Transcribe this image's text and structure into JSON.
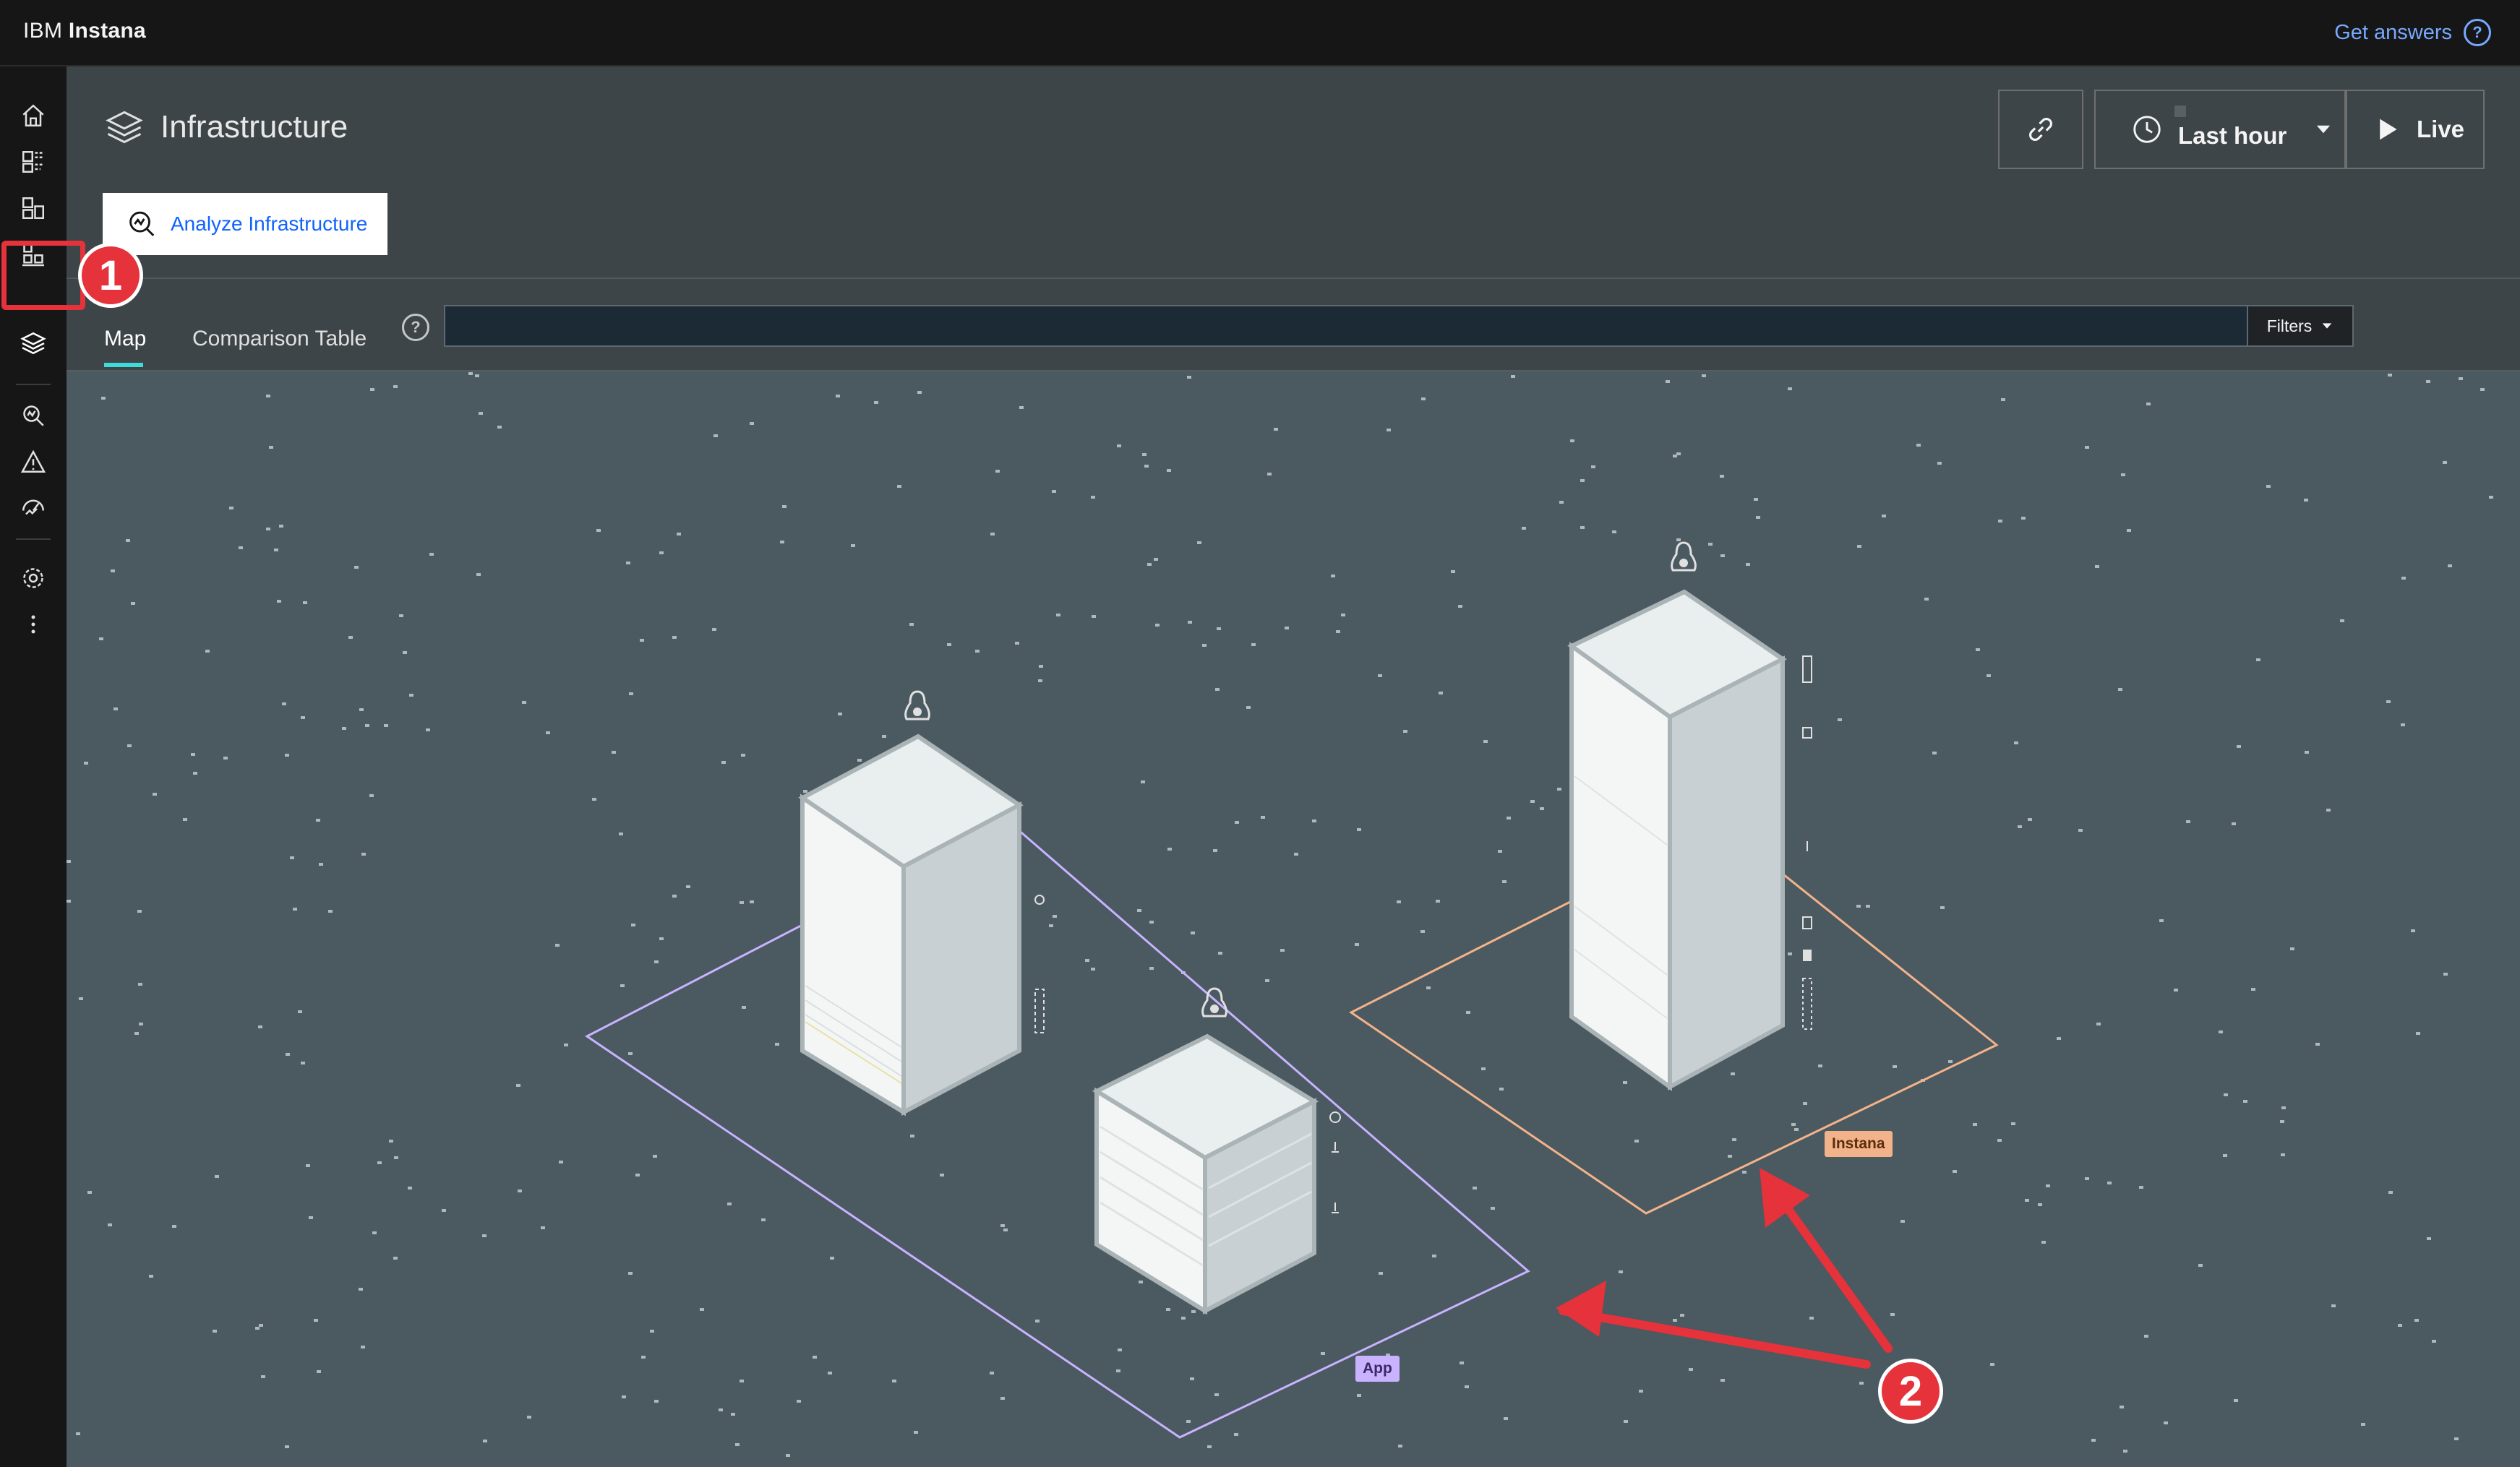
{
  "header": {
    "brand_prefix": "IBM",
    "brand_name": "Instana",
    "get_answers": "Get answers"
  },
  "sidenav": {
    "items": [
      {
        "name": "home",
        "icon": "home-icon"
      },
      {
        "name": "websites",
        "icon": "websites-icon"
      },
      {
        "name": "applications",
        "icon": "applications-icon"
      },
      {
        "name": "platforms",
        "icon": "platforms-icon"
      },
      {
        "name": "infrastructure",
        "icon": "layers-icon",
        "active": true
      },
      {
        "name": "analytics",
        "icon": "analyze-icon"
      },
      {
        "name": "events",
        "icon": "warning-icon"
      },
      {
        "name": "slo",
        "icon": "gauge-icon"
      },
      {
        "name": "settings",
        "icon": "gear-icon"
      },
      {
        "name": "more",
        "icon": "overflow-menu-icon"
      }
    ]
  },
  "page": {
    "title": "Infrastructure",
    "analyze_button": "Analyze Infrastructure"
  },
  "toolbar": {
    "time_range": "Last hour",
    "live_label": "Live"
  },
  "tabs": {
    "map": "Map",
    "comparison": "Comparison Table"
  },
  "search": {
    "value": "",
    "filters_label": "Filters"
  },
  "map": {
    "zones": [
      {
        "name": "App",
        "color": "#c9b2ff"
      },
      {
        "name": "Instana",
        "color": "#f3b38a"
      }
    ],
    "host_icon": "linux-penguin-icon"
  },
  "annotations": {
    "callout_1": "1",
    "callout_2": "2",
    "highlight_color": "#e5323b"
  }
}
